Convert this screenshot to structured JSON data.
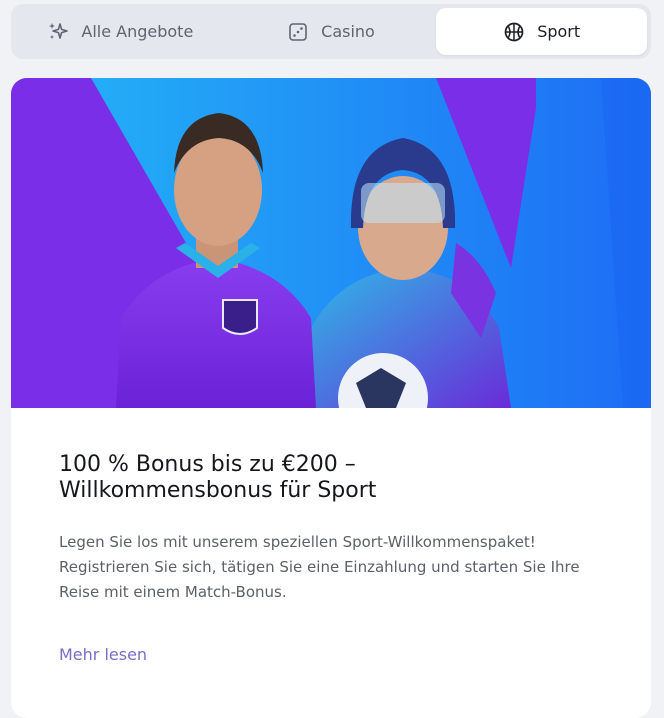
{
  "tabs": [
    {
      "label": "Alle Angebote",
      "icon": "sparkles-icon",
      "active": false
    },
    {
      "label": "Casino",
      "icon": "dice-icon",
      "active": false
    },
    {
      "label": "Sport",
      "icon": "basketball-icon",
      "active": true
    }
  ],
  "promo": {
    "title_line1": "100 % Bonus bis zu €200 –",
    "title_line2": "Willkommensbonus für Sport",
    "description": "Legen Sie los mit unserem speziellen Sport-Willkommenspaket! Registrieren Sie sich, tätigen Sie eine Einzahlung und starten Sie Ihre Reise mit einem Match-Bonus.",
    "link": "Mehr lesen"
  },
  "colors": {
    "accent_purple": "#7b2ff2",
    "accent_blue": "#1fa8f5",
    "link": "#7d6cc8"
  }
}
